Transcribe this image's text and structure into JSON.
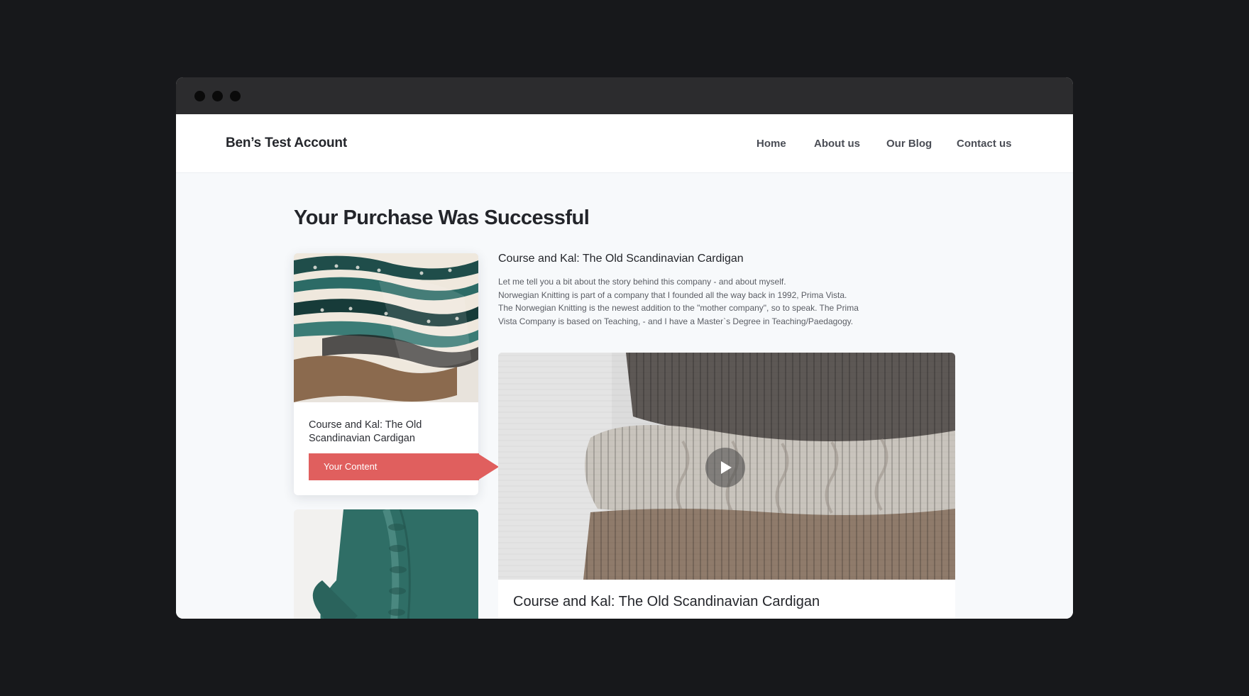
{
  "header": {
    "brand": "Ben’s Test Account",
    "nav": [
      {
        "label": "Home"
      },
      {
        "label": "About us"
      },
      {
        "label": "Our Blog"
      },
      {
        "label": "Contact us"
      }
    ]
  },
  "main": {
    "title": "Your Purchase Was Successful",
    "product_card": {
      "title": "Course and Kal: The Old Scandinavian Cardigan",
      "cta_label": "Your Content",
      "cta_color": "#e05f5e"
    },
    "course": {
      "title": "Course and Kal: The Old Scandinavian Cardigan",
      "description_lines": [
        "Let me tell you a bit about the story behind this company - and about myself.",
        "Norwegian Knitting is part of a company that I founded all the way back in 1992, Prima Vista.",
        "The Norwegian Knitting is the newest addition to the \"mother company\", so to speak. The Prima",
        "Vista Company is based on Teaching, - and I have a Master`s Degree in Teaching/Paedagogy."
      ]
    },
    "video": {
      "caption": "Course and Kal: The Old Scandinavian Cardigan",
      "play_icon": "play-icon"
    }
  }
}
